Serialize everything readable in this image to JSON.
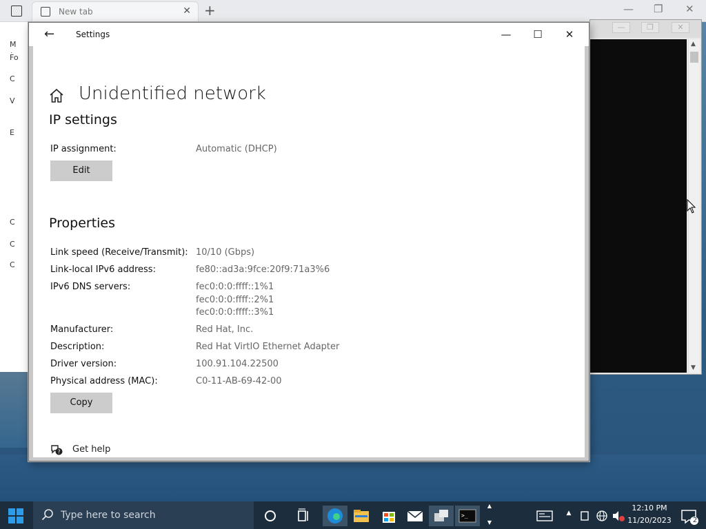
{
  "browser": {
    "tab_title": "New tab",
    "new_tab_symbol": "+",
    "close_symbol": "✕"
  },
  "peek_left_chars": [
    "M",
    "(",
    "Fo",
    "C",
    "V",
    "E",
    "C",
    "C",
    "C",
    "C"
  ],
  "settings_window": {
    "app_title": "Settings",
    "page_title": "Unidentified network",
    "ip_settings": {
      "heading": "IP settings",
      "assignment_label": "IP assignment:",
      "assignment_value": "Automatic (DHCP)",
      "edit_label": "Edit"
    },
    "properties": {
      "heading": "Properties",
      "rows": [
        {
          "label": "Link speed (Receive/Transmit):",
          "value": "10/10 (Gbps)"
        },
        {
          "label": "Link-local IPv6 address:",
          "value": "fe80::ad3a:9fce:20f9:71a3%6"
        },
        {
          "label": "IPv6 DNS servers:",
          "value": "fec0:0:0:ffff::1%1"
        },
        {
          "label": "Manufacturer:",
          "value": "Red Hat, Inc."
        },
        {
          "label": "Description:",
          "value": "Red Hat VirtIO Ethernet Adapter"
        },
        {
          "label": "Driver version:",
          "value": "100.91.104.22500"
        },
        {
          "label": "Physical address (MAC):",
          "value": "C0-11-AB-69-42-00"
        }
      ],
      "dns_extra": [
        "fec0:0:0:ffff::2%1",
        "fec0:0:0:ffff::3%1"
      ],
      "copy_label": "Copy"
    },
    "help_label": "Get help"
  },
  "taskbar": {
    "search_placeholder": "Type here to search",
    "time": "12:10 PM",
    "date": "11/20/2023",
    "notification_count": "2"
  },
  "colors": {
    "taskbar_bg": "#1c2d3d",
    "button_bg": "#cccccc",
    "start_blue": "#2e9be8",
    "edge_blue": "#1e8bd8"
  }
}
